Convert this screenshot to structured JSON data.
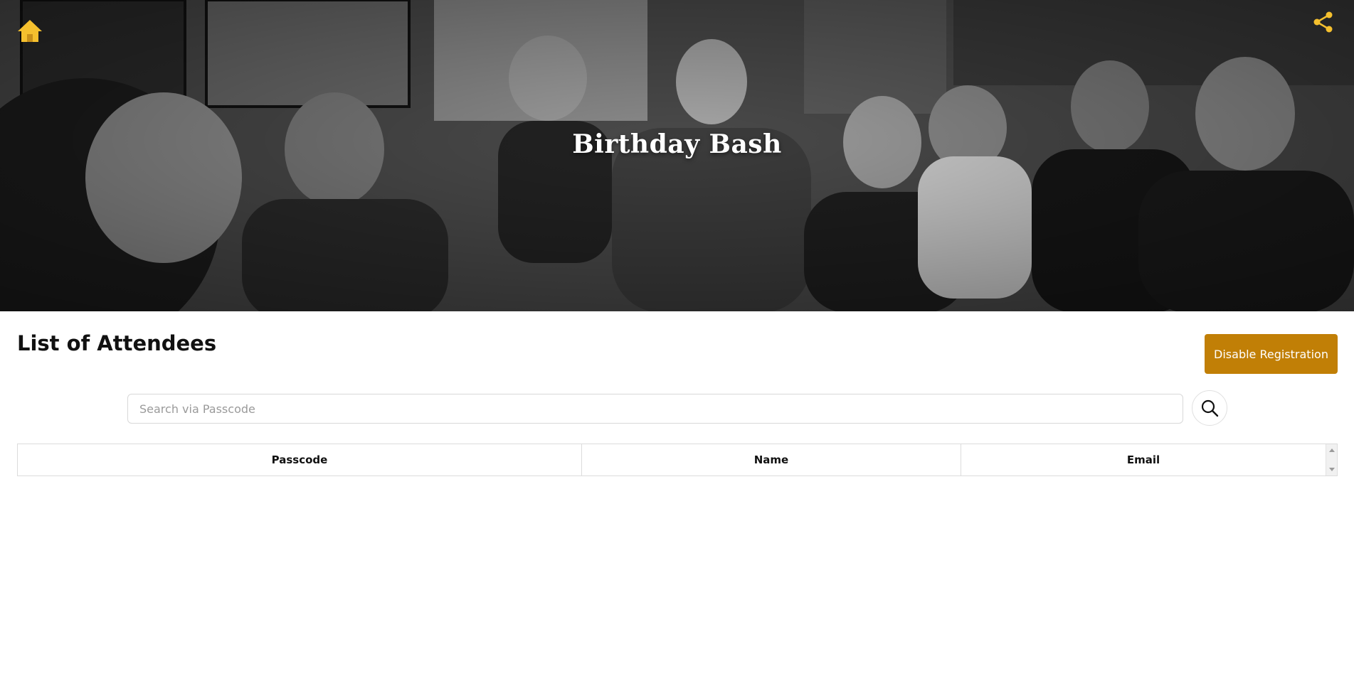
{
  "hero": {
    "title": "Birthday Bash",
    "home_icon": "home-icon",
    "share_icon": "share-icon",
    "accent_color": "#f5c02e"
  },
  "main": {
    "heading": "List of Attendees",
    "disable_button_label": "Disable Registration",
    "button_color": "#c17f06"
  },
  "search": {
    "placeholder": "Search via Passcode",
    "value": "",
    "button_icon": "search-icon"
  },
  "table": {
    "columns": [
      "Passcode",
      "Name",
      "Email"
    ],
    "rows": []
  }
}
